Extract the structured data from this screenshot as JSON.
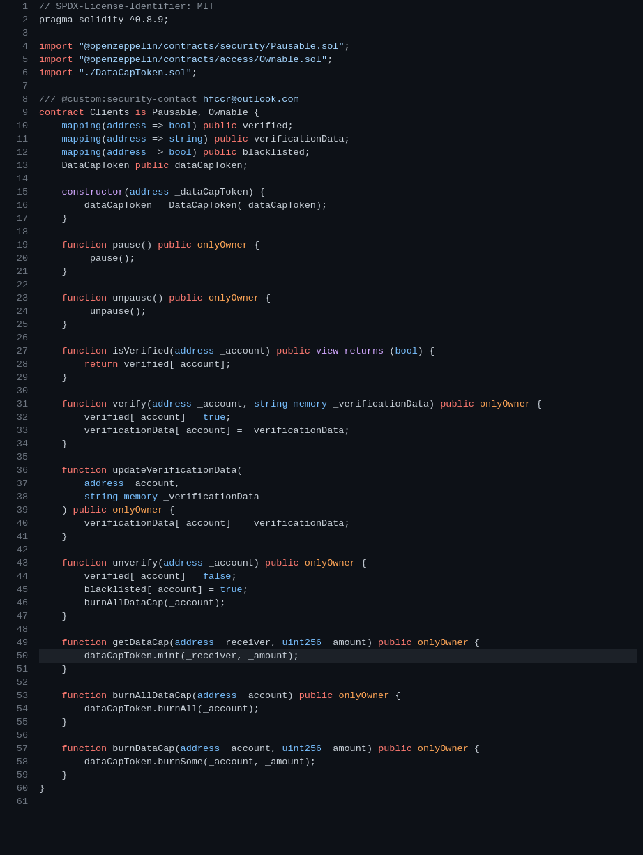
{
  "editor": {
    "background": "#0d1117",
    "highlight_line": 50,
    "lines": [
      {
        "n": 1,
        "tokens": [
          {
            "t": "comment",
            "v": "// SPDX-License-Identifier: MIT"
          }
        ]
      },
      {
        "n": 2,
        "tokens": [
          {
            "t": "plain",
            "v": "pragma solidity ^0.8.9;"
          }
        ]
      },
      {
        "n": 3,
        "tokens": []
      },
      {
        "n": 4,
        "tokens": [
          {
            "t": "keyword",
            "v": "import"
          },
          {
            "t": "plain",
            "v": " "
          },
          {
            "t": "string",
            "v": "\"@openzeppelin/contracts/security/Pausable.sol\""
          },
          {
            "t": "plain",
            "v": ";"
          }
        ]
      },
      {
        "n": 5,
        "tokens": [
          {
            "t": "keyword",
            "v": "import"
          },
          {
            "t": "plain",
            "v": " "
          },
          {
            "t": "string",
            "v": "\"@openzeppelin/contracts/access/Ownable.sol\""
          },
          {
            "t": "plain",
            "v": ";"
          }
        ]
      },
      {
        "n": 6,
        "tokens": [
          {
            "t": "keyword",
            "v": "import"
          },
          {
            "t": "plain",
            "v": " "
          },
          {
            "t": "string",
            "v": "\"./DataCapToken.sol\""
          },
          {
            "t": "plain",
            "v": ";"
          }
        ]
      },
      {
        "n": 7,
        "tokens": []
      },
      {
        "n": 8,
        "tokens": [
          {
            "t": "comment",
            "v": "/// @custom:security-contact "
          },
          {
            "t": "email",
            "v": "hfccr@outlook.com"
          }
        ]
      },
      {
        "n": 9,
        "tokens": [
          {
            "t": "keyword",
            "v": "contract"
          },
          {
            "t": "plain",
            "v": " Clients "
          },
          {
            "t": "keyword",
            "v": "is"
          },
          {
            "t": "plain",
            "v": " Pausable, Ownable {"
          }
        ]
      },
      {
        "n": 10,
        "tokens": [
          {
            "t": "plain",
            "v": "    "
          },
          {
            "t": "type",
            "v": "mapping"
          },
          {
            "t": "plain",
            "v": "("
          },
          {
            "t": "type",
            "v": "address"
          },
          {
            "t": "plain",
            "v": " => "
          },
          {
            "t": "type",
            "v": "bool"
          },
          {
            "t": "plain",
            "v": ") "
          },
          {
            "t": "keyword",
            "v": "public"
          },
          {
            "t": "plain",
            "v": " verified;"
          }
        ]
      },
      {
        "n": 11,
        "tokens": [
          {
            "t": "plain",
            "v": "    "
          },
          {
            "t": "type",
            "v": "mapping"
          },
          {
            "t": "plain",
            "v": "("
          },
          {
            "t": "type",
            "v": "address"
          },
          {
            "t": "plain",
            "v": " => "
          },
          {
            "t": "type",
            "v": "string"
          },
          {
            "t": "plain",
            "v": ") "
          },
          {
            "t": "keyword",
            "v": "public"
          },
          {
            "t": "plain",
            "v": " verificationData;"
          }
        ]
      },
      {
        "n": 12,
        "tokens": [
          {
            "t": "plain",
            "v": "    "
          },
          {
            "t": "type",
            "v": "mapping"
          },
          {
            "t": "plain",
            "v": "("
          },
          {
            "t": "type",
            "v": "address"
          },
          {
            "t": "plain",
            "v": " => "
          },
          {
            "t": "type",
            "v": "bool"
          },
          {
            "t": "plain",
            "v": ") "
          },
          {
            "t": "keyword",
            "v": "public"
          },
          {
            "t": "plain",
            "v": " blacklisted;"
          }
        ]
      },
      {
        "n": 13,
        "tokens": [
          {
            "t": "plain",
            "v": "    DataCapToken "
          },
          {
            "t": "keyword",
            "v": "public"
          },
          {
            "t": "plain",
            "v": " dataCapToken;"
          }
        ]
      },
      {
        "n": 14,
        "tokens": []
      },
      {
        "n": 15,
        "tokens": [
          {
            "t": "plain",
            "v": "    "
          },
          {
            "t": "func2",
            "v": "constructor"
          },
          {
            "t": "plain",
            "v": "("
          },
          {
            "t": "type",
            "v": "address"
          },
          {
            "t": "plain",
            "v": " _dataCapToken) {"
          }
        ]
      },
      {
        "n": 16,
        "tokens": [
          {
            "t": "plain",
            "v": "        dataCapToken = DataCapToken(_dataCapToken);"
          }
        ]
      },
      {
        "n": 17,
        "tokens": [
          {
            "t": "plain",
            "v": "    }"
          }
        ]
      },
      {
        "n": 18,
        "tokens": []
      },
      {
        "n": 19,
        "tokens": [
          {
            "t": "plain",
            "v": "    "
          },
          {
            "t": "keyword",
            "v": "function"
          },
          {
            "t": "plain",
            "v": " pause() "
          },
          {
            "t": "keyword",
            "v": "public"
          },
          {
            "t": "plain",
            "v": " "
          },
          {
            "t": "modifier",
            "v": "onlyOwner"
          },
          {
            "t": "plain",
            "v": " {"
          }
        ]
      },
      {
        "n": 20,
        "tokens": [
          {
            "t": "plain",
            "v": "        _pause();"
          }
        ]
      },
      {
        "n": 21,
        "tokens": [
          {
            "t": "plain",
            "v": "    }"
          }
        ]
      },
      {
        "n": 22,
        "tokens": []
      },
      {
        "n": 23,
        "tokens": [
          {
            "t": "plain",
            "v": "    "
          },
          {
            "t": "keyword",
            "v": "function"
          },
          {
            "t": "plain",
            "v": " unpause() "
          },
          {
            "t": "keyword",
            "v": "public"
          },
          {
            "t": "plain",
            "v": " "
          },
          {
            "t": "modifier",
            "v": "onlyOwner"
          },
          {
            "t": "plain",
            "v": " {"
          }
        ]
      },
      {
        "n": 24,
        "tokens": [
          {
            "t": "plain",
            "v": "        _unpause();"
          }
        ]
      },
      {
        "n": 25,
        "tokens": [
          {
            "t": "plain",
            "v": "    }"
          }
        ]
      },
      {
        "n": 26,
        "tokens": []
      },
      {
        "n": 27,
        "tokens": [
          {
            "t": "plain",
            "v": "    "
          },
          {
            "t": "keyword",
            "v": "function"
          },
          {
            "t": "plain",
            "v": " isVerified("
          },
          {
            "t": "type",
            "v": "address"
          },
          {
            "t": "plain",
            "v": " _account) "
          },
          {
            "t": "keyword",
            "v": "public"
          },
          {
            "t": "plain",
            "v": " "
          },
          {
            "t": "keyword2",
            "v": "view"
          },
          {
            "t": "plain",
            "v": " "
          },
          {
            "t": "keyword2",
            "v": "returns"
          },
          {
            "t": "plain",
            "v": " ("
          },
          {
            "t": "type",
            "v": "bool"
          },
          {
            "t": "plain",
            "v": ") {"
          }
        ]
      },
      {
        "n": 28,
        "tokens": [
          {
            "t": "plain",
            "v": "        "
          },
          {
            "t": "keyword",
            "v": "return"
          },
          {
            "t": "plain",
            "v": " verified[_account];"
          }
        ]
      },
      {
        "n": 29,
        "tokens": [
          {
            "t": "plain",
            "v": "    }"
          }
        ]
      },
      {
        "n": 30,
        "tokens": []
      },
      {
        "n": 31,
        "tokens": [
          {
            "t": "plain",
            "v": "    "
          },
          {
            "t": "keyword",
            "v": "function"
          },
          {
            "t": "plain",
            "v": " verify("
          },
          {
            "t": "type",
            "v": "address"
          },
          {
            "t": "plain",
            "v": " _account, "
          },
          {
            "t": "type",
            "v": "string"
          },
          {
            "t": "plain",
            "v": " "
          },
          {
            "t": "type",
            "v": "memory"
          },
          {
            "t": "plain",
            "v": " _verificationData) "
          },
          {
            "t": "keyword",
            "v": "public"
          },
          {
            "t": "plain",
            "v": " "
          },
          {
            "t": "modifier",
            "v": "onlyOwner"
          },
          {
            "t": "plain",
            "v": " {"
          }
        ]
      },
      {
        "n": 32,
        "tokens": [
          {
            "t": "plain",
            "v": "        verified[_account] = "
          },
          {
            "t": "bool",
            "v": "true"
          },
          {
            "t": "plain",
            "v": ";"
          }
        ]
      },
      {
        "n": 33,
        "tokens": [
          {
            "t": "plain",
            "v": "        verificationData[_account] = _verificationData;"
          }
        ]
      },
      {
        "n": 34,
        "tokens": [
          {
            "t": "plain",
            "v": "    }"
          }
        ]
      },
      {
        "n": 35,
        "tokens": []
      },
      {
        "n": 36,
        "tokens": [
          {
            "t": "plain",
            "v": "    "
          },
          {
            "t": "keyword",
            "v": "function"
          },
          {
            "t": "plain",
            "v": " updateVerificationData("
          }
        ]
      },
      {
        "n": 37,
        "tokens": [
          {
            "t": "plain",
            "v": "        "
          },
          {
            "t": "type",
            "v": "address"
          },
          {
            "t": "plain",
            "v": " _account,"
          }
        ]
      },
      {
        "n": 38,
        "tokens": [
          {
            "t": "plain",
            "v": "        "
          },
          {
            "t": "type",
            "v": "string"
          },
          {
            "t": "plain",
            "v": " "
          },
          {
            "t": "type",
            "v": "memory"
          },
          {
            "t": "plain",
            "v": " _verificationData"
          }
        ]
      },
      {
        "n": 39,
        "tokens": [
          {
            "t": "plain",
            "v": "    ) "
          },
          {
            "t": "keyword",
            "v": "public"
          },
          {
            "t": "plain",
            "v": " "
          },
          {
            "t": "modifier",
            "v": "onlyOwner"
          },
          {
            "t": "plain",
            "v": " {"
          }
        ]
      },
      {
        "n": 40,
        "tokens": [
          {
            "t": "plain",
            "v": "        verificationData[_account] = _verificationData;"
          }
        ]
      },
      {
        "n": 41,
        "tokens": [
          {
            "t": "plain",
            "v": "    }"
          }
        ]
      },
      {
        "n": 42,
        "tokens": []
      },
      {
        "n": 43,
        "tokens": [
          {
            "t": "plain",
            "v": "    "
          },
          {
            "t": "keyword",
            "v": "function"
          },
          {
            "t": "plain",
            "v": " unverify("
          },
          {
            "t": "type",
            "v": "address"
          },
          {
            "t": "plain",
            "v": " _account) "
          },
          {
            "t": "keyword",
            "v": "public"
          },
          {
            "t": "plain",
            "v": " "
          },
          {
            "t": "modifier",
            "v": "onlyOwner"
          },
          {
            "t": "plain",
            "v": " {"
          }
        ]
      },
      {
        "n": 44,
        "tokens": [
          {
            "t": "plain",
            "v": "        verified[_account] = "
          },
          {
            "t": "bool",
            "v": "false"
          },
          {
            "t": "plain",
            "v": ";"
          }
        ]
      },
      {
        "n": 45,
        "tokens": [
          {
            "t": "plain",
            "v": "        blacklisted[_account] = "
          },
          {
            "t": "bool",
            "v": "true"
          },
          {
            "t": "plain",
            "v": ";"
          }
        ]
      },
      {
        "n": 46,
        "tokens": [
          {
            "t": "plain",
            "v": "        burnAllDataCap(_account);"
          }
        ]
      },
      {
        "n": 47,
        "tokens": [
          {
            "t": "plain",
            "v": "    }"
          }
        ]
      },
      {
        "n": 48,
        "tokens": []
      },
      {
        "n": 49,
        "tokens": [
          {
            "t": "plain",
            "v": "    "
          },
          {
            "t": "keyword",
            "v": "function"
          },
          {
            "t": "plain",
            "v": " getDataCap("
          },
          {
            "t": "type",
            "v": "address"
          },
          {
            "t": "plain",
            "v": " _receiver, "
          },
          {
            "t": "type",
            "v": "uint256"
          },
          {
            "t": "plain",
            "v": " _amount) "
          },
          {
            "t": "keyword",
            "v": "public"
          },
          {
            "t": "plain",
            "v": " "
          },
          {
            "t": "modifier",
            "v": "onlyOwner"
          },
          {
            "t": "plain",
            "v": " {"
          }
        ]
      },
      {
        "n": 50,
        "tokens": [
          {
            "t": "plain",
            "v": "        dataCapToken.mint(_receiver, _amount);"
          }
        ]
      },
      {
        "n": 51,
        "tokens": [
          {
            "t": "plain",
            "v": "    }"
          }
        ]
      },
      {
        "n": 52,
        "tokens": []
      },
      {
        "n": 53,
        "tokens": [
          {
            "t": "plain",
            "v": "    "
          },
          {
            "t": "keyword",
            "v": "function"
          },
          {
            "t": "plain",
            "v": " burnAllDataCap("
          },
          {
            "t": "type",
            "v": "address"
          },
          {
            "t": "plain",
            "v": " _account) "
          },
          {
            "t": "keyword",
            "v": "public"
          },
          {
            "t": "plain",
            "v": " "
          },
          {
            "t": "modifier",
            "v": "onlyOwner"
          },
          {
            "t": "plain",
            "v": " {"
          }
        ]
      },
      {
        "n": 54,
        "tokens": [
          {
            "t": "plain",
            "v": "        dataCapToken.burnAll(_account);"
          }
        ]
      },
      {
        "n": 55,
        "tokens": [
          {
            "t": "plain",
            "v": "    }"
          }
        ]
      },
      {
        "n": 56,
        "tokens": []
      },
      {
        "n": 57,
        "tokens": [
          {
            "t": "plain",
            "v": "    "
          },
          {
            "t": "keyword",
            "v": "function"
          },
          {
            "t": "plain",
            "v": " burnDataCap("
          },
          {
            "t": "type",
            "v": "address"
          },
          {
            "t": "plain",
            "v": " _account, "
          },
          {
            "t": "type",
            "v": "uint256"
          },
          {
            "t": "plain",
            "v": " _amount) "
          },
          {
            "t": "keyword",
            "v": "public"
          },
          {
            "t": "plain",
            "v": " "
          },
          {
            "t": "modifier",
            "v": "onlyOwner"
          },
          {
            "t": "plain",
            "v": " {"
          }
        ]
      },
      {
        "n": 58,
        "tokens": [
          {
            "t": "plain",
            "v": "        dataCapToken.burnSome(_account, _amount);"
          }
        ]
      },
      {
        "n": 59,
        "tokens": [
          {
            "t": "plain",
            "v": "    }"
          }
        ]
      },
      {
        "n": 60,
        "tokens": [
          {
            "t": "plain",
            "v": "}"
          }
        ]
      },
      {
        "n": 61,
        "tokens": []
      }
    ]
  }
}
